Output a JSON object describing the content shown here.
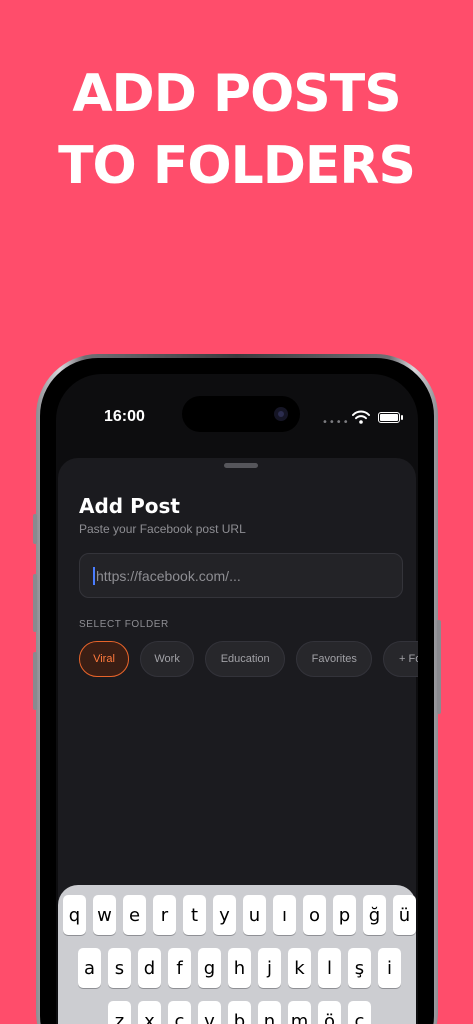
{
  "headline": {
    "line1": "ADD POSTS",
    "line2": "TO FOLDERS"
  },
  "status_bar": {
    "time": "16:00",
    "dots": "••••"
  },
  "sheet": {
    "title": "Add Post",
    "subtitle": "Paste your Facebook post URL",
    "url_placeholder": "https://facebook.com/...",
    "select_folder_label": "SELECT FOLDER",
    "folders": [
      "Viral",
      "Work",
      "Education",
      "Favorites",
      "+ Folder"
    ],
    "selected_folder": "Viral"
  },
  "keyboard": {
    "row1": [
      "q",
      "w",
      "e",
      "r",
      "t",
      "y",
      "u",
      "ı",
      "o",
      "p",
      "ğ",
      "ü"
    ],
    "row2": [
      "a",
      "s",
      "d",
      "f",
      "g",
      "h",
      "j",
      "k",
      "l",
      "ş",
      "i"
    ],
    "row3": [
      "z",
      "x",
      "c",
      "v",
      "b",
      "n",
      "m",
      "ö",
      "ç"
    ]
  },
  "colors": {
    "background": "#FF4D6B",
    "accent": "#FF7A3D",
    "cursor": "#4A7DFF"
  },
  "icons": [
    "wifi-icon",
    "battery-icon",
    "camera-icon"
  ]
}
